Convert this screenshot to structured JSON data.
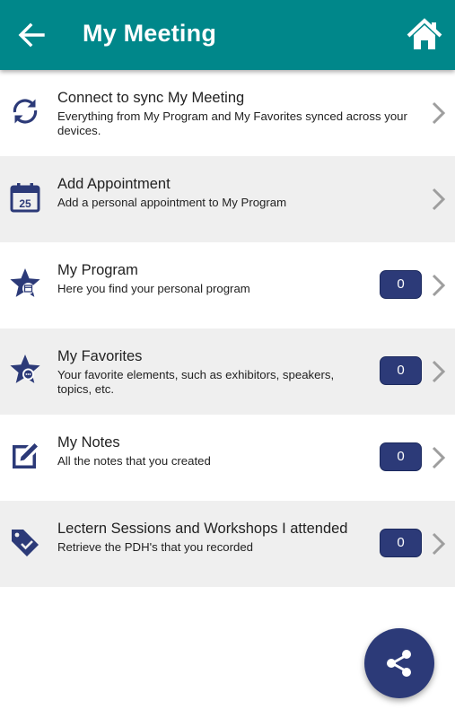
{
  "header": {
    "title": "My Meeting",
    "back_icon": "arrow-left-icon",
    "home_icon": "home-icon",
    "background_color": "#00878a"
  },
  "items": [
    {
      "title": "Connect to sync My Meeting",
      "subtitle": "Everything from My Program and My Favorites synced across your devices.",
      "icon": "sync-icon"
    },
    {
      "title": "Add Appointment",
      "subtitle": "Add a personal appointment to My Program",
      "icon": "calendar-icon",
      "icon_text": "25"
    },
    {
      "title": "My Program",
      "subtitle": "Here you find your personal program",
      "icon": "star-calendar-icon",
      "count": "0"
    },
    {
      "title": "My Favorites",
      "subtitle": "Your favorite elements, such as exhibitors, speakers, topics, etc.",
      "icon": "star-chat-icon",
      "count": "0"
    },
    {
      "title": "My Notes",
      "subtitle": "All the notes that you created",
      "icon": "note-pencil-icon",
      "count": "0"
    },
    {
      "title": "Lectern Sessions and Workshops I attended",
      "subtitle": "Retrieve the PDH's that you recorded",
      "icon": "tag-check-icon",
      "count": "0"
    }
  ],
  "share_button": {
    "icon": "share-icon"
  },
  "colors": {
    "accent_navy": "#2c3a78",
    "row_alt": "#efefef",
    "chevron": "#9e9e9e"
  }
}
